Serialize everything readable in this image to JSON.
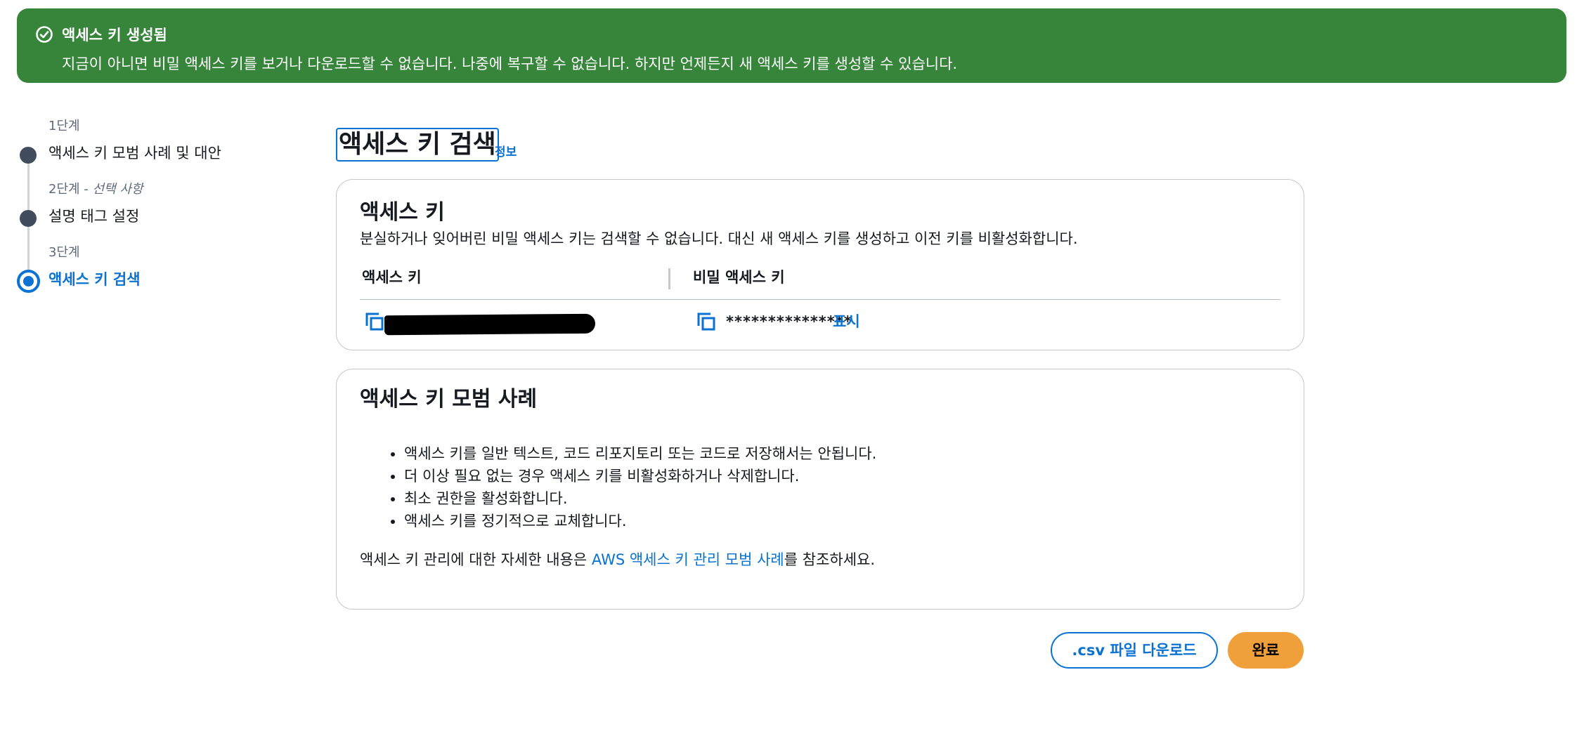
{
  "banner": {
    "title": "액세스 키 생성됨",
    "message": "지금이 아니면 비밀 액세스 키를 보거나 다운로드할 수 없습니다. 나중에 복구할 수 없습니다. 하지만 언제든지 새 액세스 키를 생성할 수 있습니다.",
    "icon": "check-circle-icon",
    "color": "#37843b"
  },
  "steps": [
    {
      "sub": "1단계",
      "sub_note": "",
      "label": "액세스 키 모범 사례 및 대안",
      "state": "done"
    },
    {
      "sub": "2단계 - ",
      "sub_note": "선택 사항",
      "label": "설명 태그 설정",
      "state": "done"
    },
    {
      "sub": "3단계",
      "sub_note": "",
      "label": "액세스 키 검색",
      "state": "current"
    }
  ],
  "page": {
    "title": "액세스 키 검색",
    "info": "정보"
  },
  "access_key_card": {
    "title": "액세스 키",
    "description": "분실하거나 잊어버린 비밀 액세스 키는 검색할 수 없습니다. 대신 새 액세스 키를 생성하고 이전 키를 비활성화합니다.",
    "col_access_key": "액세스 키",
    "col_secret_key": "비밀 액세스 키",
    "secret_masked": "***************",
    "show": "표시"
  },
  "best_practices_card": {
    "title": "액세스 키 모범 사례",
    "items": [
      "액세스 키를 일반 텍스트, 코드 리포지토리 또는 코드로 저장해서는 안됩니다.",
      "더 이상 필요 없는 경우 액세스 키를 비활성화하거나 삭제합니다.",
      "최소 권한을 활성화합니다.",
      "액세스 키를 정기적으로 교체합니다."
    ],
    "footer_prefix": "액세스 키 관리에 대한 자세한 내용은 ",
    "footer_link": "AWS 액세스 키 관리 모범 사례",
    "footer_suffix": "를 참조하세요."
  },
  "actions": {
    "download_csv": ".csv 파일 다운로드",
    "done": "완료"
  },
  "colors": {
    "accent": "#0972d3",
    "primary_button": "#f0a03a"
  }
}
